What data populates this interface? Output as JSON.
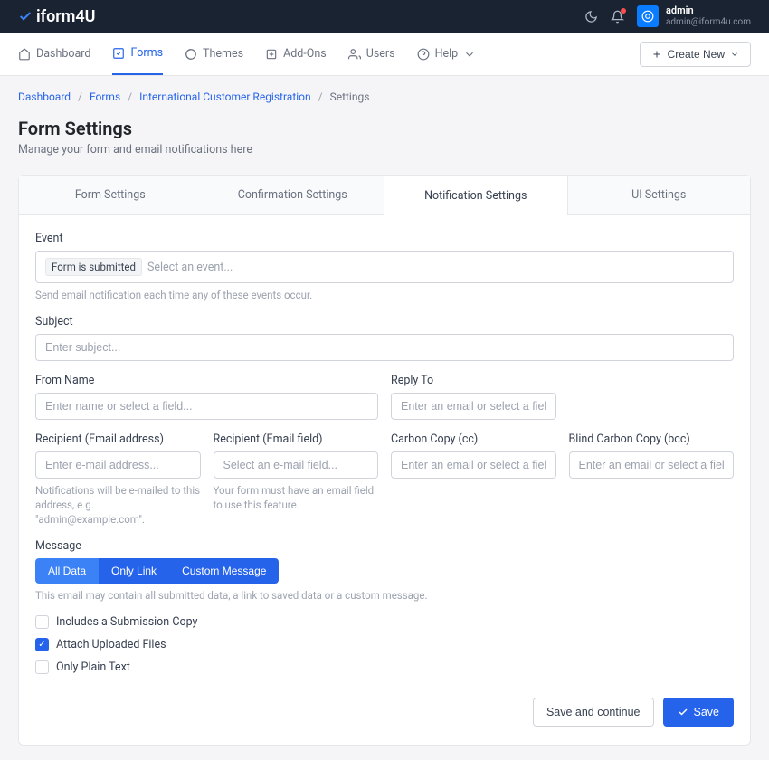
{
  "brand": "iform4U",
  "user": {
    "name": "admin",
    "email": "admin@iform4u.com"
  },
  "nav": {
    "dashboard": "Dashboard",
    "forms": "Forms",
    "themes": "Themes",
    "addons": "Add-Ons",
    "users": "Users",
    "help": "Help",
    "create": "Create New"
  },
  "breadcrumb": {
    "dashboard": "Dashboard",
    "forms": "Forms",
    "form_name": "International Customer Registration",
    "current": "Settings"
  },
  "page": {
    "title": "Form Settings",
    "subtitle": "Manage your form and email notifications here"
  },
  "tabs": {
    "form": "Form Settings",
    "confirmation": "Confirmation Settings",
    "notification": "Notification Settings",
    "ui": "UI Settings"
  },
  "fields": {
    "event": {
      "label": "Event",
      "tag": "Form is submitted",
      "placeholder": "Select an event...",
      "helper": "Send email notification each time any of these events occur."
    },
    "subject": {
      "label": "Subject",
      "placeholder": "Enter subject..."
    },
    "from_name": {
      "label": "From Name",
      "placeholder": "Enter name or select a field..."
    },
    "reply_to": {
      "label": "Reply To",
      "placeholder": "Enter an email or select a field..."
    },
    "recipient_email": {
      "label": "Recipient (Email address)",
      "placeholder": "Enter e-mail address...",
      "helper": "Notifications will be e-mailed to this address, e.g. \"admin@example.com\"."
    },
    "recipient_field": {
      "label": "Recipient (Email field)",
      "placeholder": "Select an e-mail field...",
      "helper": "Your form must have an email field to use this feature."
    },
    "cc": {
      "label": "Carbon Copy (cc)",
      "placeholder": "Enter an email or select a field..."
    },
    "bcc": {
      "label": "Blind Carbon Copy (bcc)",
      "placeholder": "Enter an email or select a field..."
    },
    "message": {
      "label": "Message",
      "all_data": "All Data",
      "only_link": "Only Link",
      "custom": "Custom Message",
      "helper": "This email may contain all submitted data, a link to saved data or a custom message."
    },
    "checks": {
      "submission_copy": "Includes a Submission Copy",
      "attach_files": "Attach Uploaded Files",
      "plain_text": "Only Plain Text"
    }
  },
  "buttons": {
    "save_continue": "Save and continue",
    "save": "Save"
  }
}
